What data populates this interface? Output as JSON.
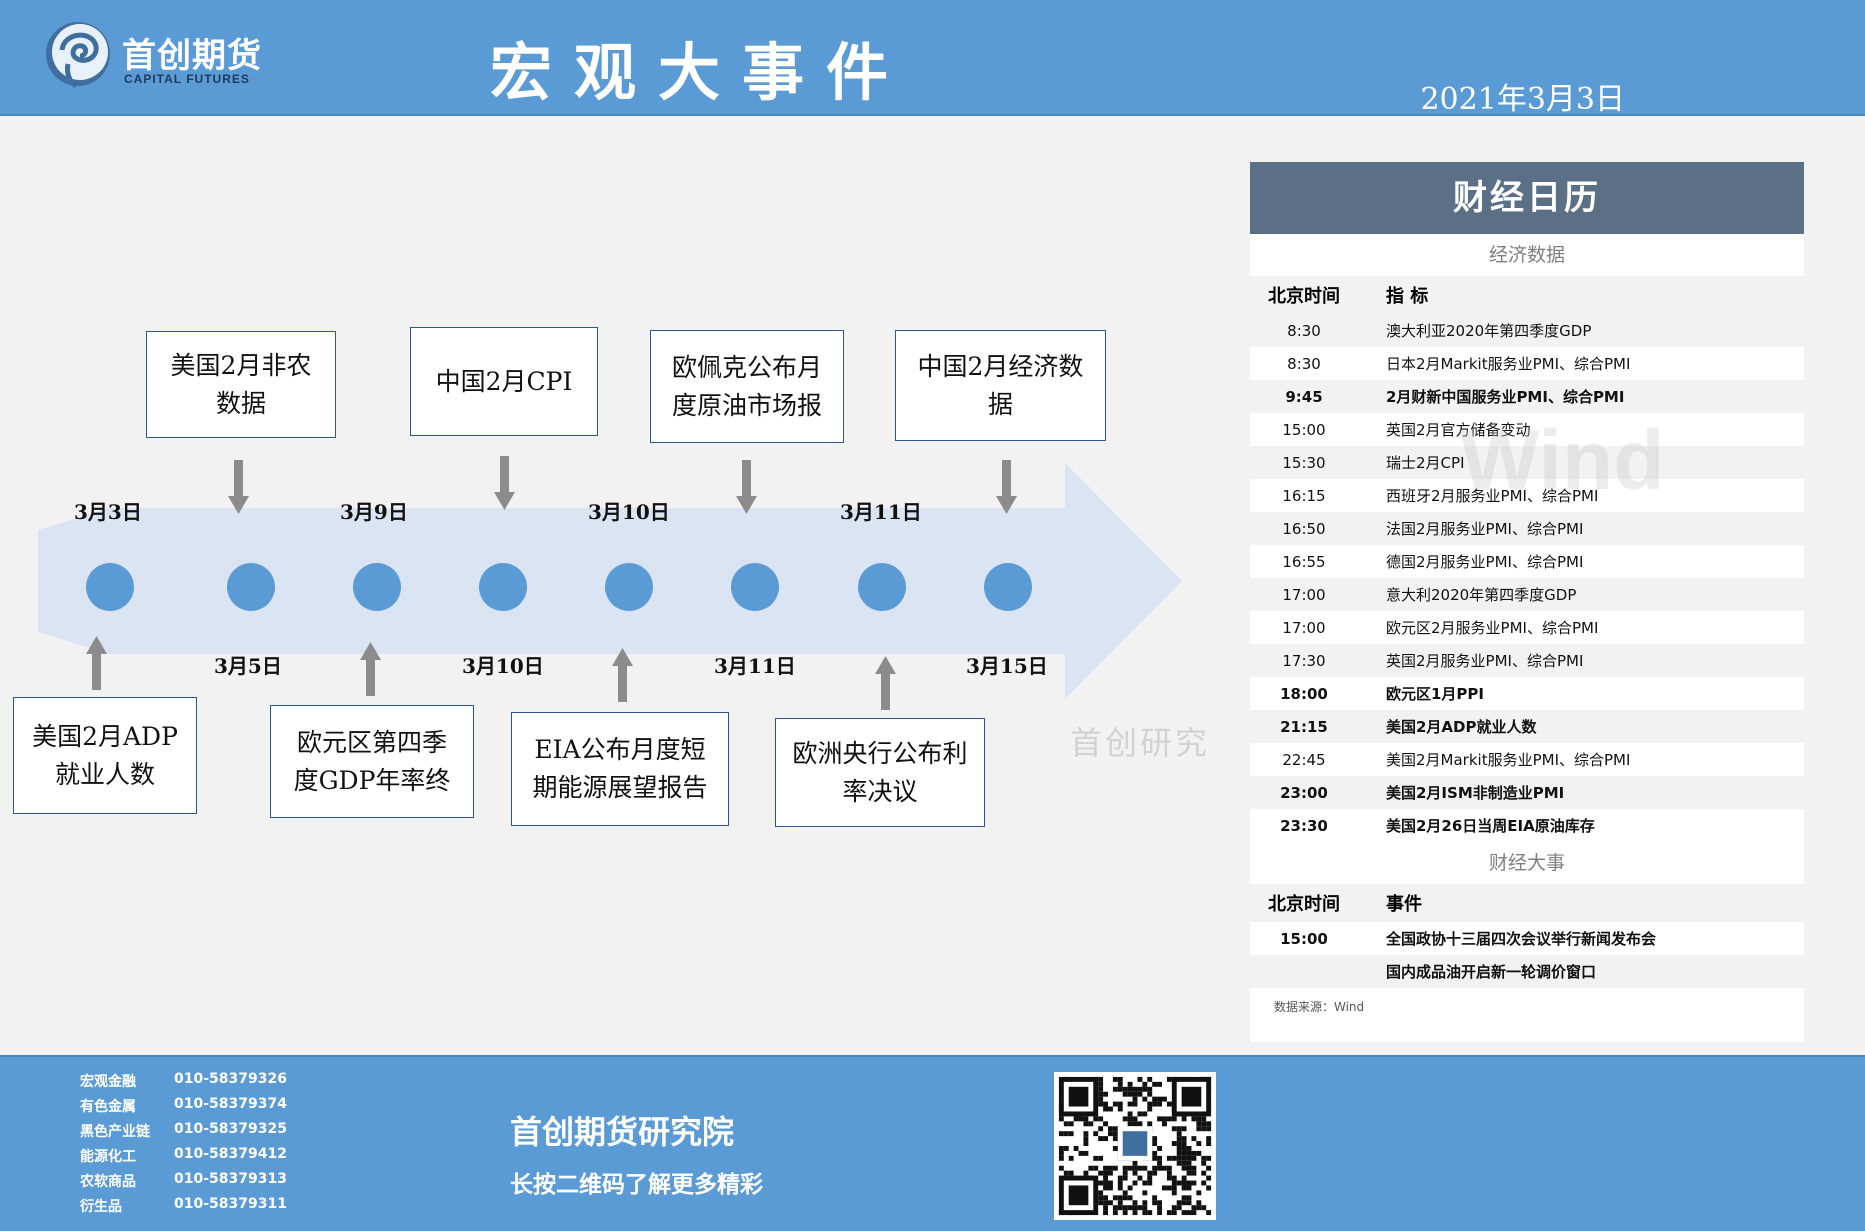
{
  "header": {
    "logo_name": "首创期货",
    "logo_en": "CAPITAL FUTURES",
    "title": "宏观大事件",
    "date": "2021年3月3日"
  },
  "timeline": {
    "top_dates": [
      "3月3日",
      "3月9日",
      "3月10日",
      "3月11日"
    ],
    "bottom_dates": [
      "3月5日",
      "3月10日",
      "3月11日",
      "3月15日"
    ],
    "top_events": [
      {
        "line1": "美国2月非农",
        "line2": "数据"
      },
      {
        "line1": "中国2月CPI",
        "line2": ""
      },
      {
        "line1": "欧佩克公布月",
        "line2": "度原油市场报"
      },
      {
        "line1": "中国2月经济数",
        "line2": "据"
      }
    ],
    "bottom_events": [
      {
        "line1": "美国2月ADP",
        "line2": "就业人数"
      },
      {
        "line1": "欧元区第四季",
        "line2": "度GDP年率终"
      },
      {
        "line1": "EIA公布月度短",
        "line2": "期能源展望报告"
      },
      {
        "line1": "欧洲央行公布利",
        "line2": "率决议"
      }
    ],
    "watermark": "首创研究"
  },
  "calendar": {
    "title": "财经日历",
    "econ_section": "经济数据",
    "col_time": "北京时间",
    "col_indicator": "指  标",
    "wind_watermark": "Wind",
    "econ_rows": [
      {
        "time": "8:30",
        "name": "澳大利亚2020年第四季度GDP",
        "bold": false
      },
      {
        "time": "8:30",
        "name": "日本2月Markit服务业PMI、综合PMI",
        "bold": false
      },
      {
        "time": "9:45",
        "name": "2月财新中国服务业PMI、综合PMI",
        "bold": true
      },
      {
        "time": "15:00",
        "name": "英国2月官方储备变动",
        "bold": false
      },
      {
        "time": "15:30",
        "name": "瑞士2月CPI",
        "bold": false
      },
      {
        "time": "16:15",
        "name": "西班牙2月服务业PMI、综合PMI",
        "bold": false
      },
      {
        "time": "16:50",
        "name": "法国2月服务业PMI、综合PMI",
        "bold": false
      },
      {
        "time": "16:55",
        "name": "德国2月服务业PMI、综合PMI",
        "bold": false
      },
      {
        "time": "17:00",
        "name": "意大利2020年第四季度GDP",
        "bold": false
      },
      {
        "time": "17:00",
        "name": "欧元区2月服务业PMI、综合PMI",
        "bold": false
      },
      {
        "time": "17:30",
        "name": "英国2月服务业PMI、综合PMI",
        "bold": false
      },
      {
        "time": "18:00",
        "name": "欧元区1月PPI",
        "bold": true
      },
      {
        "time": "21:15",
        "name": "美国2月ADP就业人数",
        "bold": true
      },
      {
        "time": "22:45",
        "name": "美国2月Markit服务业PMI、综合PMI",
        "bold": false
      },
      {
        "time": "23:00",
        "name": "美国2月ISM非制造业PMI",
        "bold": true
      },
      {
        "time": "23:30",
        "name": "美国2月26日当周EIA原油库存",
        "bold": true
      }
    ],
    "event_section": "财经大事",
    "col_event": "事件",
    "event_rows": [
      {
        "time": "15:00",
        "name": "全国政协十三届四次会议举行新闻发布会"
      },
      {
        "time": "",
        "name": "国内成品油开启新一轮调价窗口"
      }
    ],
    "source": "数据来源：Wind"
  },
  "footer": {
    "contacts": [
      {
        "dept": "宏观金融",
        "phone": "010-58379326"
      },
      {
        "dept": "有色金属",
        "phone": "010-58379374"
      },
      {
        "dept": "黑色产业链",
        "phone": "010-58379325"
      },
      {
        "dept": "能源化工",
        "phone": "010-58379412"
      },
      {
        "dept": "农软商品",
        "phone": "010-58379313"
      },
      {
        "dept": "衍生品",
        "phone": "010-58379311"
      }
    ],
    "institute": "首创期货研究院",
    "slogan": "长按二维码了解更多精彩"
  },
  "colors": {
    "header_bg": "#5b9bd5",
    "calendar_head": "#5b6f86",
    "arrow": "#dbe4f3",
    "dot": "#5b9bd5"
  }
}
